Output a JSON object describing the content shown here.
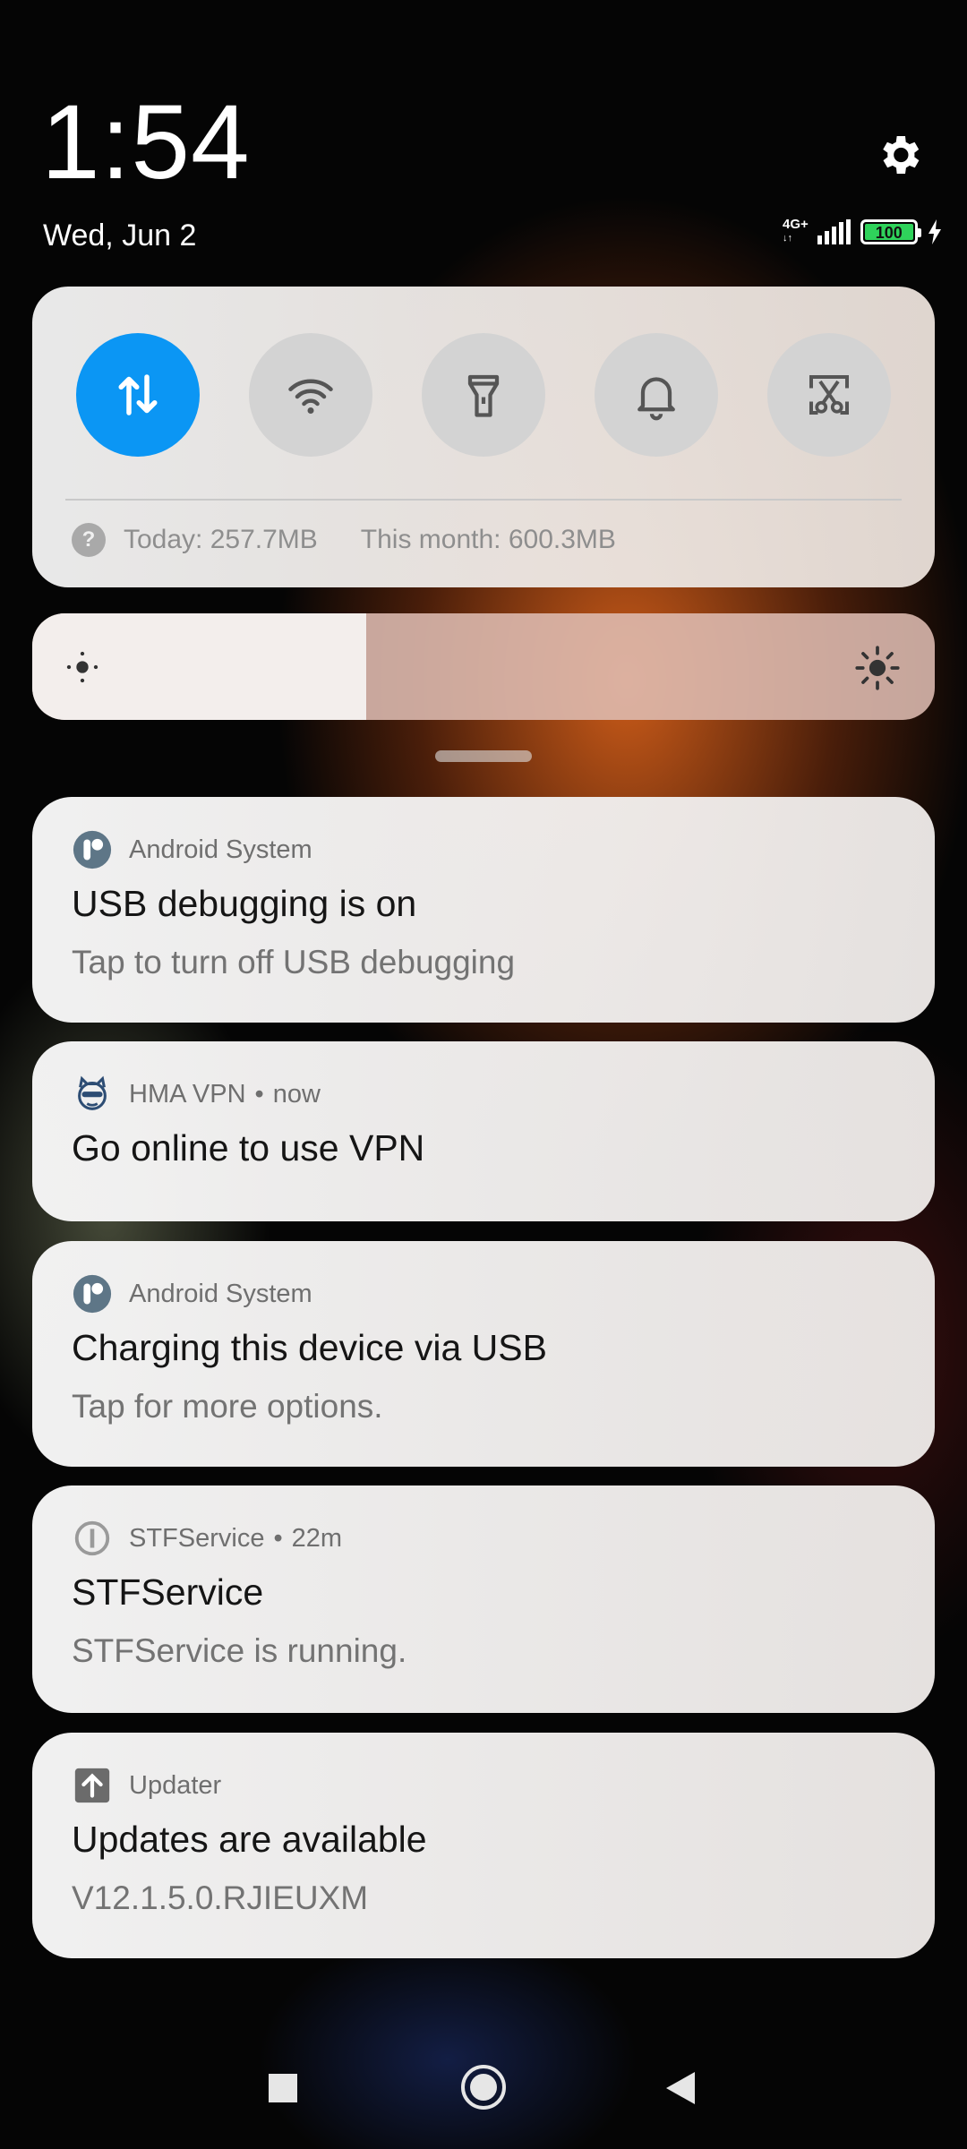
{
  "status_bar": {
    "time": "1:54",
    "date": "Wed, Jun 2",
    "network_label": "4G+",
    "battery_level": "100",
    "settings_icon": "gear-icon"
  },
  "quick_settings": {
    "tiles": [
      {
        "name": "mobile-data",
        "icon": "data-transfer-icon",
        "active": true
      },
      {
        "name": "wifi",
        "icon": "wifi-icon",
        "active": false
      },
      {
        "name": "flashlight",
        "icon": "flashlight-icon",
        "active": false
      },
      {
        "name": "sound",
        "icon": "bell-icon",
        "active": false
      },
      {
        "name": "screenshot",
        "icon": "scissors-icon",
        "active": false
      }
    ],
    "usage_today": "Today: 257.7MB",
    "usage_month": "This month: 600.3MB",
    "accent_color": "#0b96f4"
  },
  "brightness": {
    "level": 0.37
  },
  "notifications": [
    {
      "app": "Android System",
      "time": "",
      "title": "USB debugging is on",
      "body": "Tap to turn off USB debugging"
    },
    {
      "app": "HMA VPN",
      "time": "now",
      "title": "Go online to use VPN",
      "body": ""
    },
    {
      "app": "Android System",
      "time": "",
      "title": "Charging this device via USB",
      "body": "Tap for more options."
    },
    {
      "app": "STFService",
      "time": "22m",
      "title": "STFService",
      "body": "STFService is running."
    },
    {
      "app": "Updater",
      "time": "",
      "title": "Updates are available",
      "body": "V12.1.5.0.RJIEUXM"
    }
  ]
}
